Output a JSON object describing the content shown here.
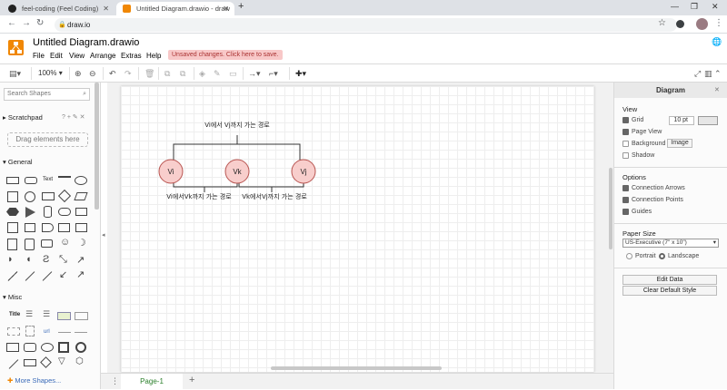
{
  "browser": {
    "tabs": [
      {
        "title": "feel-coding (Feel Coding)"
      },
      {
        "title": "Untitled Diagram.drawio - draw"
      }
    ],
    "url": "draw.io"
  },
  "app": {
    "document_title": "Untitled Diagram.drawio",
    "menus": [
      "File",
      "Edit",
      "View",
      "Arrange",
      "Extras",
      "Help"
    ],
    "unsaved_notice": "Unsaved changes. Click here to save."
  },
  "toolbar": {
    "zoom": "100%"
  },
  "sidebar": {
    "search_placeholder": "Search Shapes",
    "scratchpad_label": "Scratchpad",
    "drag_hint": "Drag elements here",
    "general_label": "General",
    "misc_label": "Misc",
    "text_shape": "Text",
    "title_shape": "Title",
    "url_shape": "url",
    "more_shapes": "More Shapes..."
  },
  "diagram": {
    "top_label": "Vi에서 Vj까지 가는 경로",
    "left_label": "Vi에서Vk까지 가는 경로",
    "right_label": "Vk에서Vj까지 가는 경로",
    "nodes": [
      "Vi",
      "Vk",
      "Vj"
    ],
    "node_fill": "#f8cecc",
    "node_stroke": "#b85450"
  },
  "pages": [
    "Page-1"
  ],
  "format_panel": {
    "title": "Diagram",
    "view_label": "View",
    "grid_label": "Grid",
    "grid_size": "10 pt",
    "page_view_label": "Page View",
    "background_label": "Background",
    "image_button": "Image",
    "shadow_label": "Shadow",
    "options_label": "Options",
    "connection_arrows_label": "Connection Arrows",
    "connection_points_label": "Connection Points",
    "guides_label": "Guides",
    "paper_size_label": "Paper Size",
    "paper_size_value": "US-Executive (7\" x 10\")",
    "portrait_label": "Portrait",
    "landscape_label": "Landscape",
    "edit_data_button": "Edit Data",
    "clear_style_button": "Clear Default Style"
  }
}
